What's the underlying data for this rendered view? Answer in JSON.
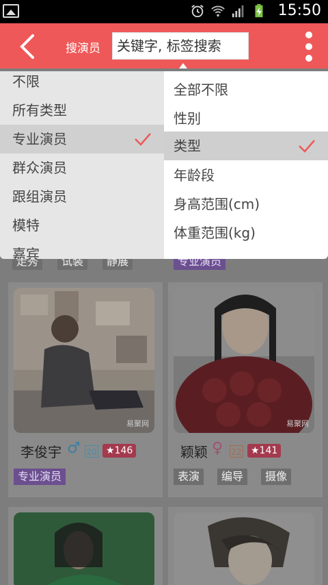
{
  "status_bar": {
    "time": "15:50"
  },
  "header": {
    "title": "搜演员",
    "search_placeholder": "关键字, 标签搜索"
  },
  "filter_left": {
    "items": [
      "不限",
      "所有类型",
      "专业演员",
      "群众演员",
      "跟组演员",
      "模特",
      "嘉宾"
    ],
    "selected_index": 2
  },
  "filter_right": {
    "items": [
      "全部不限",
      "性别",
      "类型",
      "年龄段",
      "身高范围(cm)",
      "体重范围(kg)"
    ],
    "selected_index": 2
  },
  "cards": [
    {
      "name": "李俊宇",
      "age": "20",
      "stars": "★146",
      "tags": [
        "专业演员"
      ],
      "watermark": "易聚网"
    },
    {
      "name": "颖颖",
      "age": "22",
      "stars": "★141",
      "tags": [
        "表演",
        "编导",
        "摄像"
      ],
      "watermark": "易聚网"
    }
  ],
  "partial_tags_left": [
    "走秀",
    "试装",
    "静展"
  ],
  "partial_tags_right": [
    "专业演员"
  ],
  "colors": {
    "accent": "#ef5858",
    "check": "#ef5858"
  }
}
